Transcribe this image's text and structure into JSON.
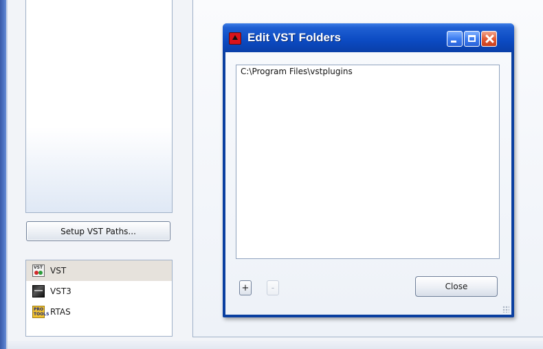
{
  "sidebar": {
    "setup_button_label": "Setup VST Paths...",
    "plugin_types": [
      {
        "label": "VST",
        "icon": "vst-icon",
        "selected": true
      },
      {
        "label": "VST3",
        "icon": "vst3-icon",
        "selected": false
      },
      {
        "label": "RTAS",
        "icon": "rtas-icon",
        "selected": false
      }
    ],
    "rtas_icon_text": [
      "PRO",
      "TOOLS"
    ]
  },
  "dialog": {
    "title": "Edit VST Folders",
    "folders": [
      "C:\\Program Files\\vstplugins"
    ],
    "add_label": "+",
    "remove_label": "-",
    "close_label": "Close"
  },
  "colors": {
    "titlebar": "#0b4ac2",
    "close_button": "#e25b36",
    "selected_row": "#e6e2dc"
  }
}
